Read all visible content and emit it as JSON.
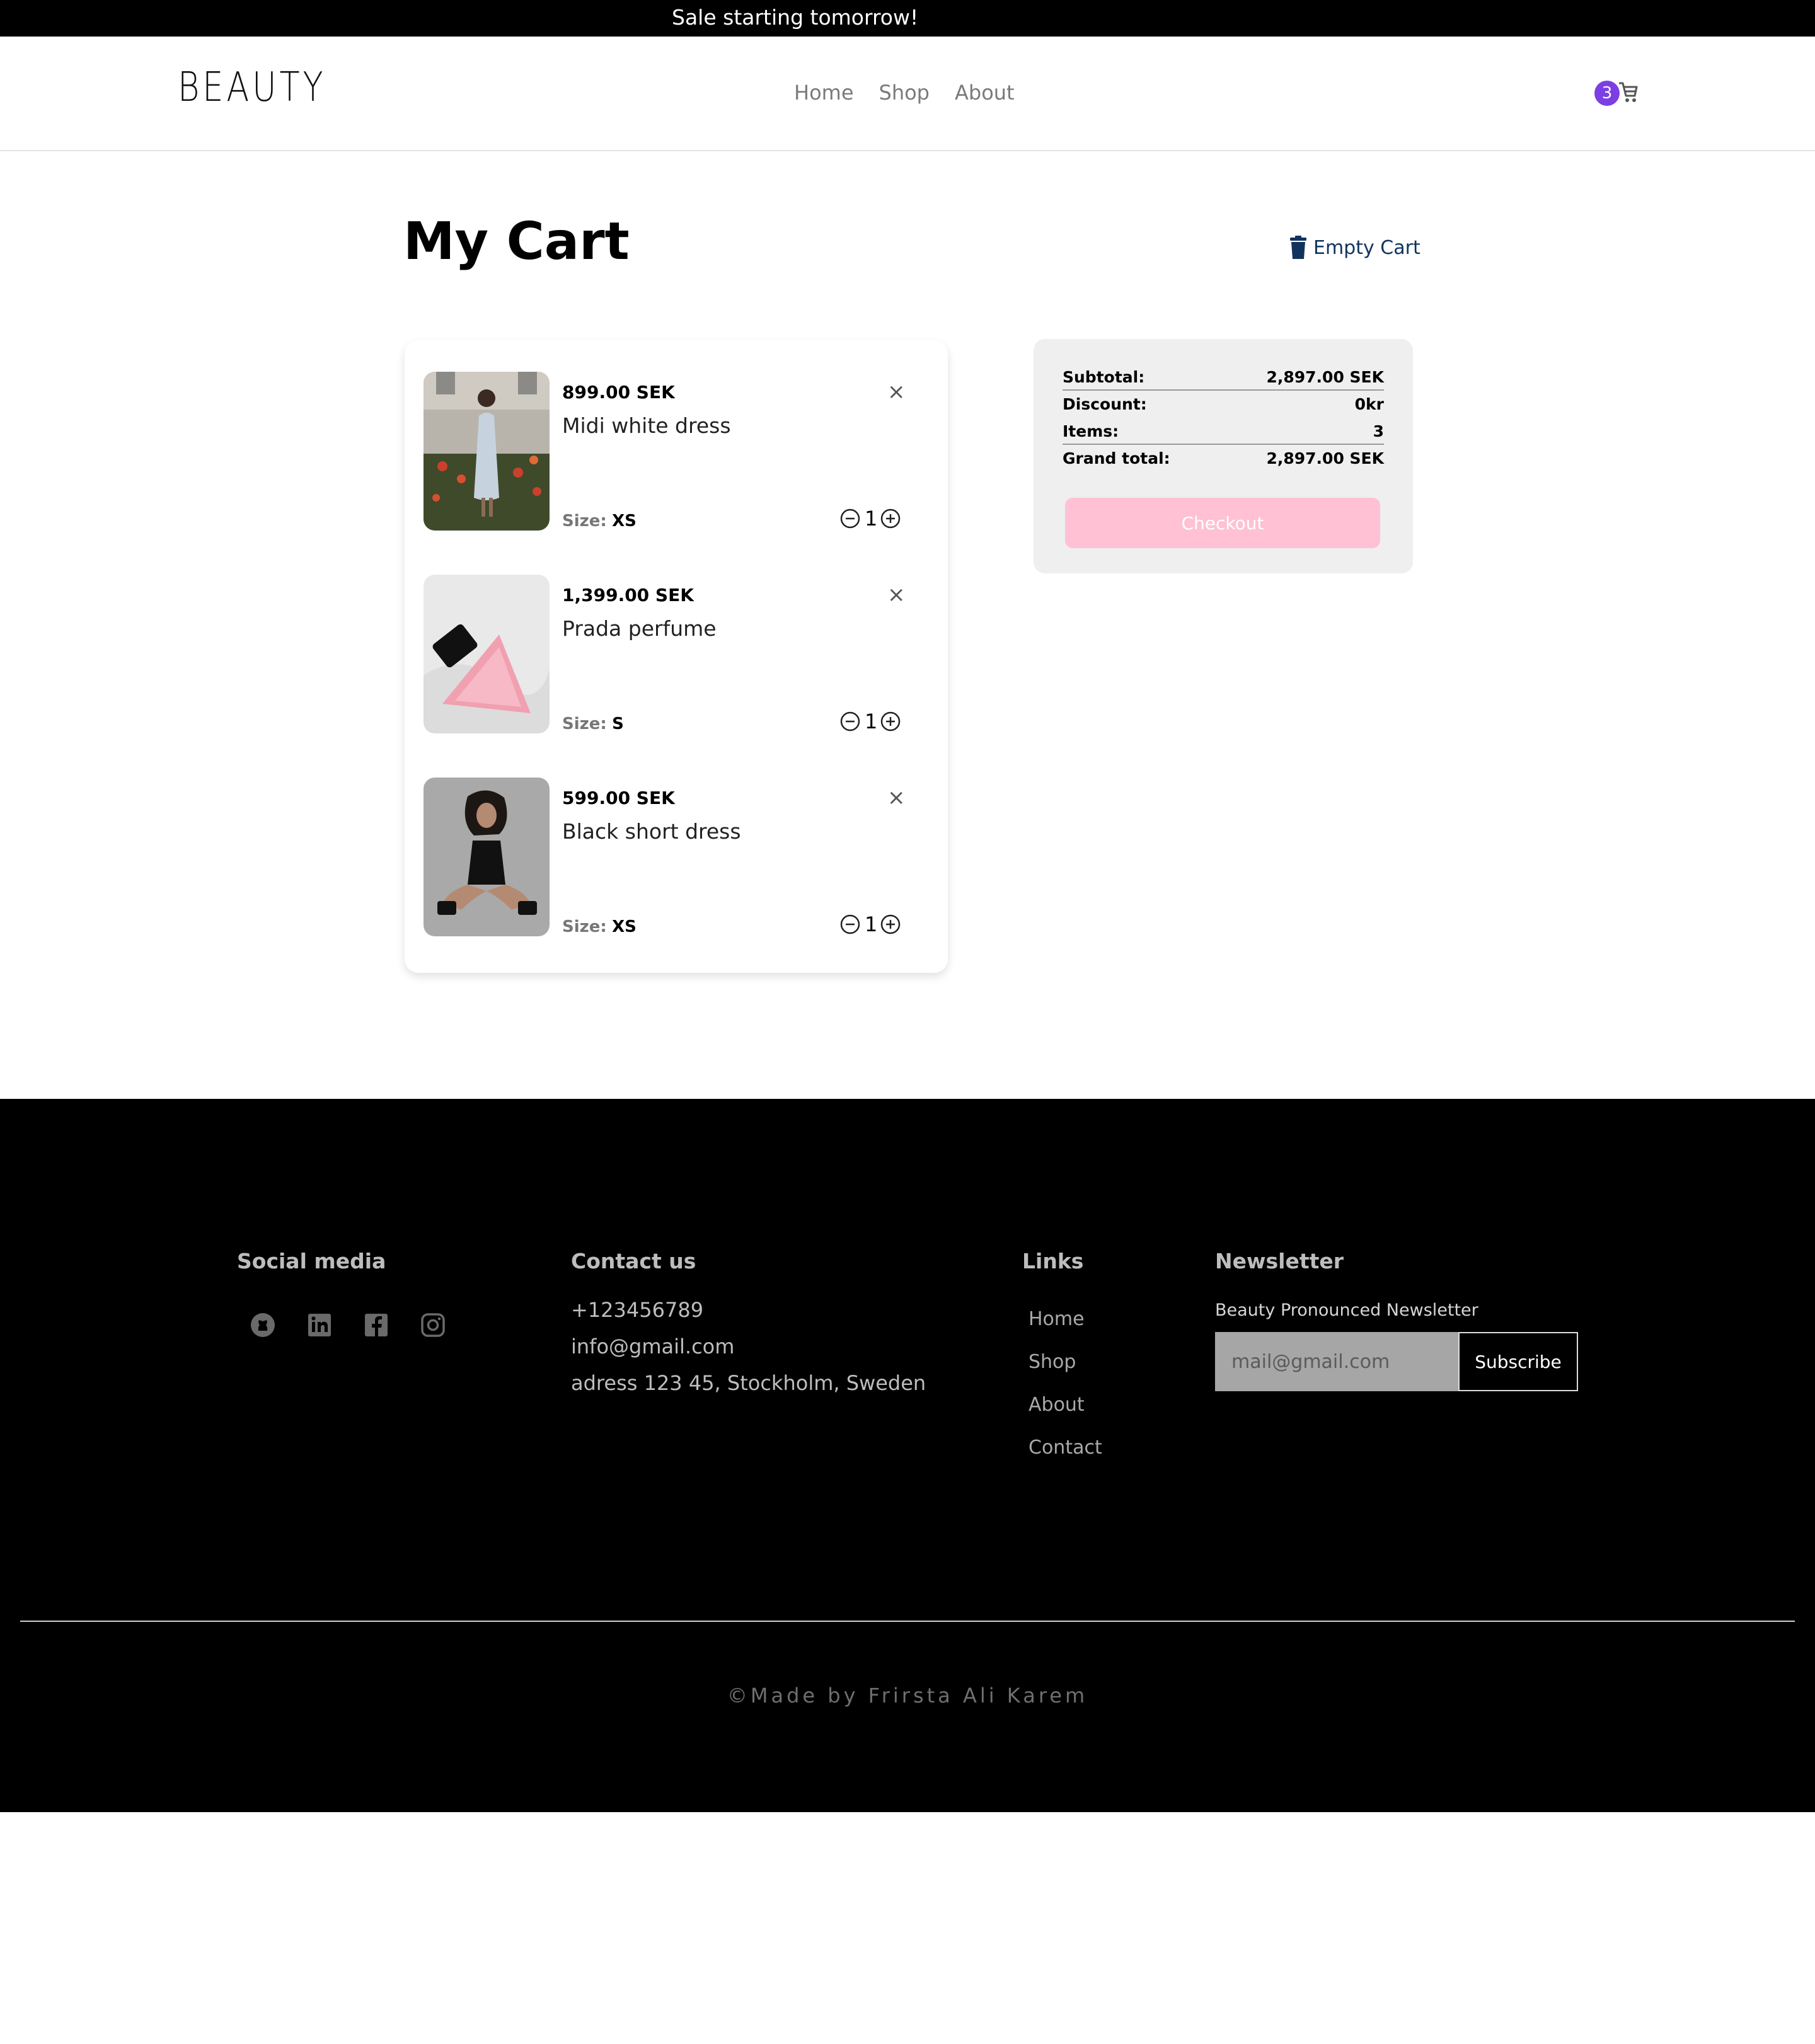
{
  "announcement": "Sale starting tomorrow!",
  "header": {
    "logo": "BEAUTY",
    "nav": [
      "Home",
      "Shop",
      "About"
    ],
    "cart_count": "3"
  },
  "cart": {
    "title": "My Cart",
    "empty_label": "Empty Cart",
    "size_label": "Size:",
    "items": [
      {
        "price": "899.00 SEK",
        "name": "Midi white dress",
        "size": "XS",
        "qty": "1"
      },
      {
        "price": "1,399.00 SEK",
        "name": "Prada perfume",
        "size": "S",
        "qty": "1"
      },
      {
        "price": "599.00 SEK",
        "name": "Black short dress",
        "size": "XS",
        "qty": "1"
      }
    ]
  },
  "summary": {
    "subtotal_label": "Subtotal:",
    "subtotal": "2,897.00 SEK",
    "discount_label": "Discount:",
    "discount": "0kr",
    "items_label": "Items:",
    "items": "3",
    "grand_label": "Grand total:",
    "grand": "2,897.00 SEK",
    "checkout": "Checkout"
  },
  "footer": {
    "social_title": "Social media",
    "social_icons": [
      "github-icon",
      "linkedin-icon",
      "facebook-icon",
      "instagram-icon"
    ],
    "contact_title": "Contact us",
    "phone": "+123456789",
    "email": "info@gmail.com",
    "address": "adress 123 45, Stockholm, Sweden",
    "links_title": "Links",
    "links": [
      "Home",
      "Shop",
      "About",
      "Contact"
    ],
    "newsletter_title": "Newsletter",
    "newsletter_label": "Beauty Pronounced Newsletter",
    "newsletter_placeholder": "mail@gmail.com",
    "subscribe": "Subscribe",
    "copyright": "©Made by Frirsta Ali Karem"
  },
  "colors": {
    "badge": "#7b3fe4",
    "checkout": "#ffc1d3",
    "empty_cart": "#10335e"
  }
}
